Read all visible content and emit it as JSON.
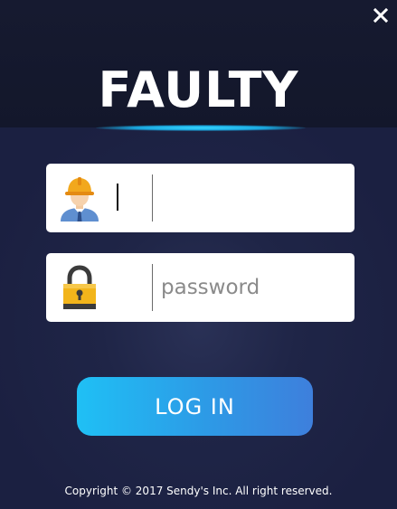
{
  "window": {
    "close_icon": "close-icon"
  },
  "header": {
    "title": "FAULTY",
    "accent_color": "#1fc0f5"
  },
  "form": {
    "username": {
      "icon": "worker-helmet-icon",
      "value": "",
      "placeholder": ""
    },
    "password": {
      "icon": "padlock-icon",
      "value": "",
      "placeholder": "password"
    },
    "login_label": "LOG IN"
  },
  "footer": {
    "copyright": "Copyright © 2017 Sendy's Inc. All right reserved."
  }
}
